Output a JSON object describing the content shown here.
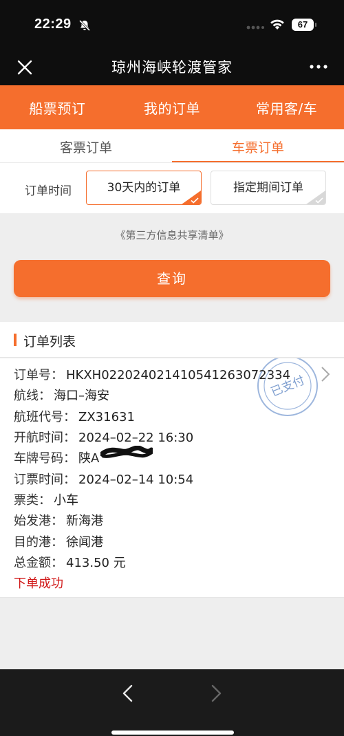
{
  "status_bar": {
    "time": "22:29",
    "battery": "67"
  },
  "titlebar": {
    "title": "琼州海峡轮渡管家"
  },
  "main_nav": [
    {
      "label": "船票预订"
    },
    {
      "label": "我的订单"
    },
    {
      "label": "常用客/车"
    }
  ],
  "sub_tabs": [
    {
      "label": "客票订单",
      "active": false
    },
    {
      "label": "车票订单",
      "active": true
    }
  ],
  "filter": {
    "label": "订单时间",
    "options": [
      {
        "label": "30天内的订单",
        "selected": true
      },
      {
        "label": "指定期间订单",
        "selected": false
      }
    ]
  },
  "third_party_link": "《第三方信息共享清单》",
  "query_button": "查询",
  "order_list": {
    "title": "订单列表",
    "orders": [
      {
        "stamp": "已支付",
        "fields": [
          {
            "label": "订单号：",
            "value": "HKXH022024021410541263072334"
          },
          {
            "label": "航线：",
            "value": "海口–海安"
          },
          {
            "label": "航班代号：",
            "value": "ZX31631"
          },
          {
            "label": "开航时间：",
            "value": "2024–02–22 16:30"
          },
          {
            "label": "车牌号码：",
            "value": "陕A"
          },
          {
            "label": "订票时间：",
            "value": "2024–02–14 10:54"
          },
          {
            "label": "票类：",
            "value": "小车"
          },
          {
            "label": "始发港：",
            "value": "新海港"
          },
          {
            "label": "目的港：",
            "value": "徐闻港"
          },
          {
            "label": "总金额：",
            "value": "413.50 元"
          }
        ],
        "status": "下单成功"
      }
    ]
  },
  "colors": {
    "accent": "#f56e2d",
    "dark": "#0e0e0e",
    "status_red": "#d11a1a",
    "stamp_blue": "#6b93c8"
  }
}
